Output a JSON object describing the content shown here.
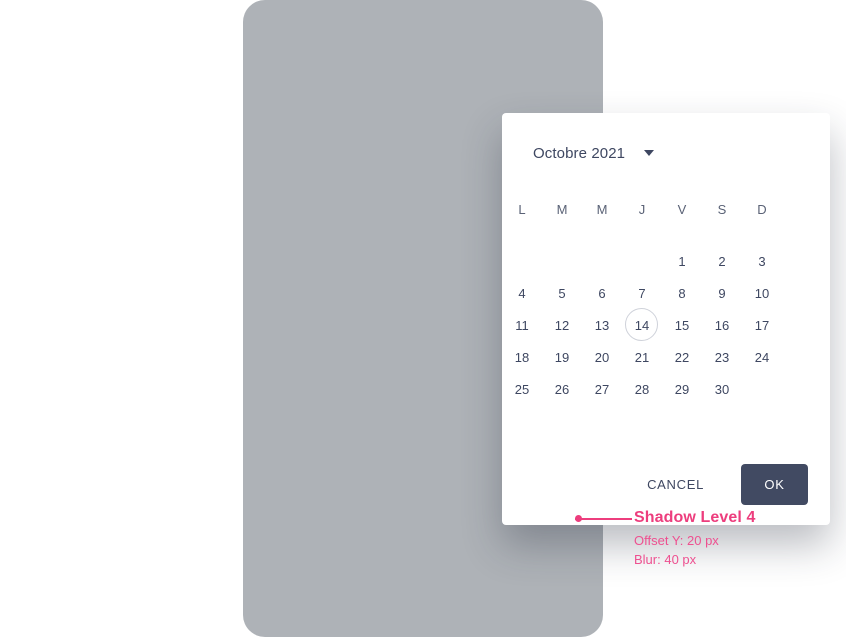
{
  "phone": {
    "background_color": "#AEB2B7"
  },
  "datepicker": {
    "header": {
      "month_year": "Octobre 2021",
      "dropdown_icon": "chevron-down-icon",
      "prev_icon": "chevron-left-icon",
      "next_icon": "chevron-right-icon"
    },
    "weekdays": [
      "L",
      "M",
      "M",
      "J",
      "V",
      "S",
      "D"
    ],
    "weeks": [
      [
        "",
        "",
        "",
        "",
        "1",
        "2",
        "3"
      ],
      [
        "4",
        "5",
        "6",
        "7",
        "8",
        "9",
        "10"
      ],
      [
        "11",
        "12",
        "13",
        "14",
        "15",
        "16",
        "17"
      ],
      [
        "18",
        "19",
        "20",
        "21",
        "22",
        "23",
        "24"
      ],
      [
        "25",
        "26",
        "27",
        "28",
        "29",
        "30",
        ""
      ]
    ],
    "today": "14",
    "actions": {
      "cancel_label": "CANCEL",
      "ok_label": "OK",
      "ok_color": "#414A62"
    }
  },
  "annotation": {
    "title": "Shadow Level 4",
    "lines": [
      "Offset Y: 20 px",
      "Blur: 40 px"
    ],
    "accent_color": "#ED3D7D"
  }
}
